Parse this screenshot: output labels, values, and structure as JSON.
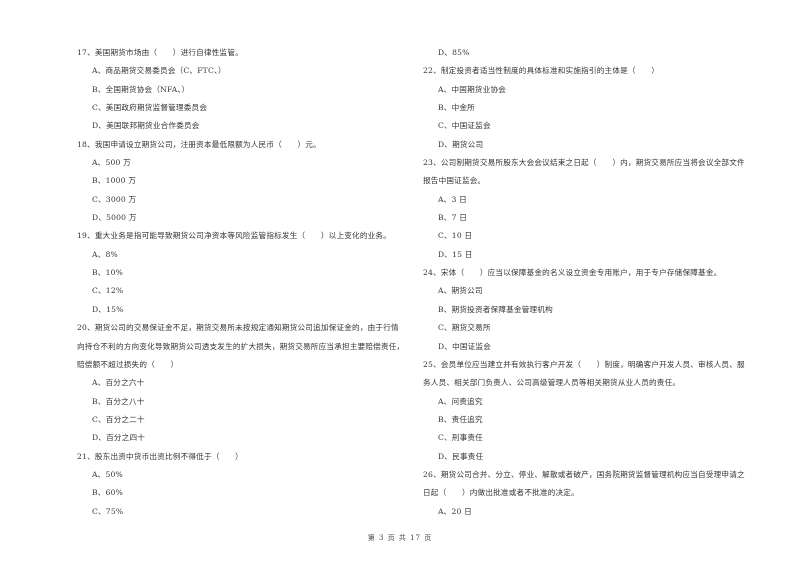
{
  "left_column": {
    "items": [
      {
        "kind": "q",
        "text": "17、美国期货市场由（　　）进行自律性监管。"
      },
      {
        "kind": "o",
        "text": "A、商品期货交易委员会（C、FTC、）"
      },
      {
        "kind": "o",
        "text": "B、全国期货协会（NFA、）"
      },
      {
        "kind": "o",
        "text": "C、美国政府期货监督管理委员会"
      },
      {
        "kind": "o",
        "text": "D、美国联邦期货业合作委员会"
      },
      {
        "kind": "q",
        "text": "18、我国申请设立期货公司，注册资本最低限额为人民币（　　）元。"
      },
      {
        "kind": "o",
        "text": "A、500 万"
      },
      {
        "kind": "o",
        "text": "B、1000 万"
      },
      {
        "kind": "o",
        "text": "C、3000 万"
      },
      {
        "kind": "o",
        "text": "D、5000 万"
      },
      {
        "kind": "q",
        "text": "19、重大业务是指可能导致期货公司净资本等风险监管指标发生（　　）以上变化的业务。"
      },
      {
        "kind": "o",
        "text": "A、8%"
      },
      {
        "kind": "o",
        "text": "B、10%"
      },
      {
        "kind": "o",
        "text": "C、12%"
      },
      {
        "kind": "o",
        "text": "D、15%"
      },
      {
        "kind": "q",
        "text": "20、期货公司的交易保证金不足，期货交易所未按规定通知期货公司追加保证金的，由于行情"
      },
      {
        "kind": "q",
        "text": "向持仓不利的方向变化导致期货公司透支发生的扩大损失，期货交易所应当承担主要赔偿责任，"
      },
      {
        "kind": "q",
        "text": "赔偿额不超过损失的（　　）"
      },
      {
        "kind": "o",
        "text": "A、百分之六十"
      },
      {
        "kind": "o",
        "text": "B、百分之八十"
      },
      {
        "kind": "o",
        "text": "C、百分之二十"
      },
      {
        "kind": "o",
        "text": "D、百分之四十"
      },
      {
        "kind": "q",
        "text": "21、股东出资中货币出资比例不得低于（　　）"
      },
      {
        "kind": "o",
        "text": "A、50%"
      },
      {
        "kind": "o",
        "text": "B、60%"
      },
      {
        "kind": "o",
        "text": "C、75%"
      }
    ]
  },
  "right_column": {
    "items": [
      {
        "kind": "o",
        "text": "D、85%"
      },
      {
        "kind": "q",
        "text": "22、制定投资者适当性制度的具体标准和实施指引的主体是（　　）"
      },
      {
        "kind": "o",
        "text": "A、中国期货业协会"
      },
      {
        "kind": "o",
        "text": "B、中金所"
      },
      {
        "kind": "o",
        "text": "C、中国证监会"
      },
      {
        "kind": "o",
        "text": "D、期货公司"
      },
      {
        "kind": "q",
        "text": "23、公司制期货交易所股东大会会议结束之日起（　　）内，期货交易所应当将会议全部文件"
      },
      {
        "kind": "q",
        "text": "报告中国证监会。"
      },
      {
        "kind": "o",
        "text": "A、3 日"
      },
      {
        "kind": "o",
        "text": "B、7 日"
      },
      {
        "kind": "o",
        "text": "C、10 日"
      },
      {
        "kind": "o",
        "text": "D、15 日"
      },
      {
        "kind": "q",
        "text": "24、宋体（　　）应当以保障基金的名义设立资金专用账户，用于专户存储保障基金。"
      },
      {
        "kind": "o",
        "text": "A、期货公司"
      },
      {
        "kind": "o",
        "text": "B、期货投资者保障基金管理机构"
      },
      {
        "kind": "o",
        "text": "C、期货交易所"
      },
      {
        "kind": "o",
        "text": "D、中国证监会"
      },
      {
        "kind": "q",
        "text": "25、会员单位应当建立并有效执行客户开发（　　）制度，明确客户开发人员、审核人员、服"
      },
      {
        "kind": "q",
        "text": "务人员、相关部门负责人、公司高级管理人员等相关期货从业人员的责任。"
      },
      {
        "kind": "o",
        "text": "A、问责追究"
      },
      {
        "kind": "o",
        "text": "B、责任追究"
      },
      {
        "kind": "o",
        "text": "C、刑事责任"
      },
      {
        "kind": "o",
        "text": "D、民事责任"
      },
      {
        "kind": "q",
        "text": "26、期货公司合并、分立、停业、解散或者破产，国务院期货监督管理机构应当自受理申请之"
      },
      {
        "kind": "q",
        "text": "日起（　　）内做出批准或者不批准的决定。"
      },
      {
        "kind": "o",
        "text": "A、20 日"
      }
    ]
  },
  "footer": {
    "page_label": "第 3 页 共 17 页"
  }
}
